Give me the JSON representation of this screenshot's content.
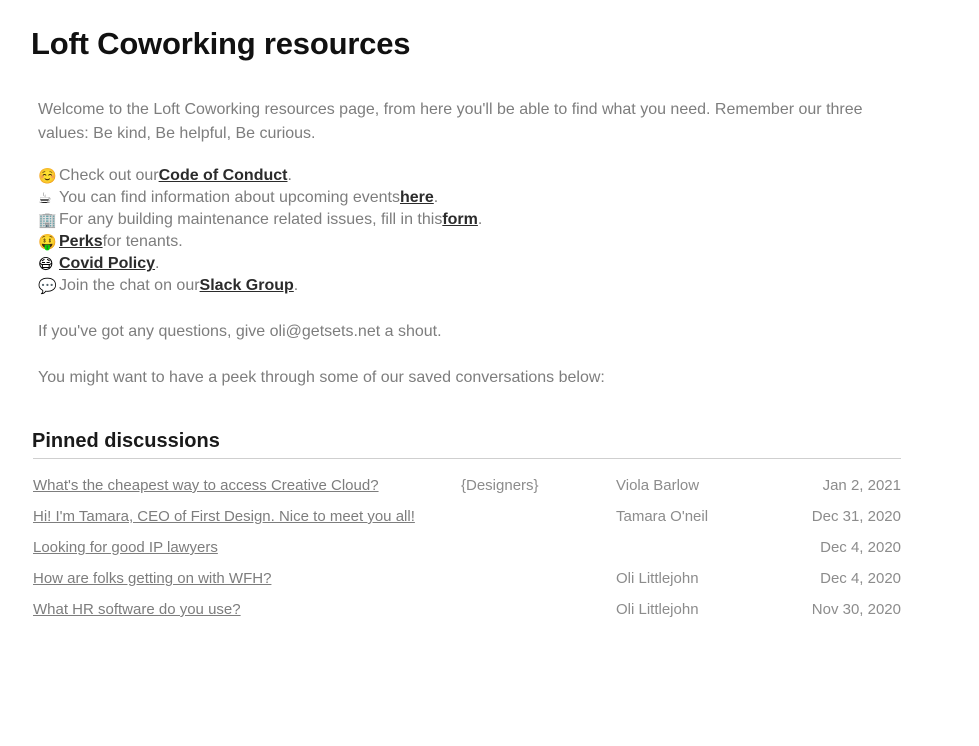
{
  "page": {
    "title": "Loft Coworking resources",
    "intro": "Welcome to the Loft Coworking resources page, from here you'll be able to find what you need. Remember our three values: Be kind, Be helpful, Be curious.",
    "questions_line": "If you've got any questions, give oli@getsets.net a shout.",
    "peek_line": "You might want to have a peek through some of our saved conversations below:"
  },
  "links": [
    {
      "icon": "smiling-face-emoji",
      "glyph": "☺️",
      "before": "Check out our ",
      "link": "Code of Conduct",
      "after": "."
    },
    {
      "icon": "hot-beverage-emoji",
      "glyph": "☕",
      "before": "You can find information about upcoming events ",
      "link": "here",
      "after": "."
    },
    {
      "icon": "office-building-emoji",
      "glyph": "🏢",
      "before": "For any building maintenance related issues, fill in this ",
      "link": "form",
      "after": "."
    },
    {
      "icon": "money-mouth-face-emoji",
      "glyph": "🤑",
      "before": "",
      "link": "Perks",
      "after": " for tenants."
    },
    {
      "icon": "face-with-medical-mask-emoji",
      "glyph": "😷",
      "before": "",
      "link": "Covid Policy",
      "after": "."
    },
    {
      "icon": "speech-balloon-emoji",
      "glyph": "💬",
      "before": "Join the chat on our ",
      "link": "Slack Group",
      "after": "."
    }
  ],
  "pinned": {
    "heading": "Pinned discussions",
    "rows": [
      {
        "title": "What's the cheapest way to access Creative Cloud?",
        "tag": "{Designers}",
        "author": "Viola Barlow",
        "date": "Jan 2, 2021"
      },
      {
        "title": "Hi! I'm Tamara, CEO of First Design. Nice to meet you all!",
        "tag": "",
        "author": "Tamara O'neil",
        "date": "Dec 31, 2020"
      },
      {
        "title": "Looking for good IP lawyers",
        "tag": "",
        "author": "",
        "date": "Dec 4, 2020"
      },
      {
        "title": "How are folks getting on with WFH?",
        "tag": "",
        "author": "Oli Littlejohn",
        "date": "Dec 4, 2020"
      },
      {
        "title": "What HR software do you use?",
        "tag": "",
        "author": "Oli Littlejohn",
        "date": "Nov 30, 2020"
      }
    ]
  },
  "colors": {
    "background": "#ffffff",
    "body_text": "#7d7d7d",
    "heading_text": "#111111",
    "link_text": "#2b2b2b",
    "rule": "#cfcfcf"
  }
}
